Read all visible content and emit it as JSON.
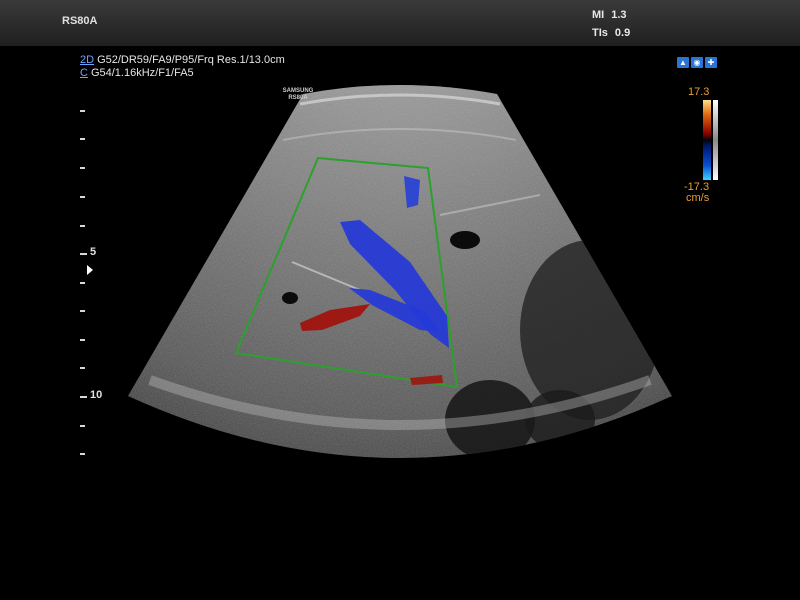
{
  "header": {
    "model": "RS80A",
    "mi_label": "MI",
    "mi_value": "1.3",
    "tis_label": "TIs",
    "tis_value": "0.9"
  },
  "parameters": {
    "mode_2d": "2D",
    "line_2d": "G52/DR59/FA9/P95/Frq Res.1/13.0cm",
    "mode_color": "C",
    "line_color": "G54/1.16kHz/F1/FA5"
  },
  "watermark": {
    "brand": "SAMSUNG",
    "model": "RS80A"
  },
  "color_scale": {
    "max": "17.3",
    "min": "-17.3",
    "unit": "cm/s"
  },
  "depth_scale": {
    "label_5": "5",
    "label_10": "10"
  },
  "probe_icons": [
    "probe-icon",
    "body-icon",
    "settings-icon"
  ],
  "colors": {
    "flow_away": "#2438d8",
    "flow_toward": "#a0140e",
    "roi_box": "#2ca02c",
    "scale_text": "#e8a030"
  }
}
